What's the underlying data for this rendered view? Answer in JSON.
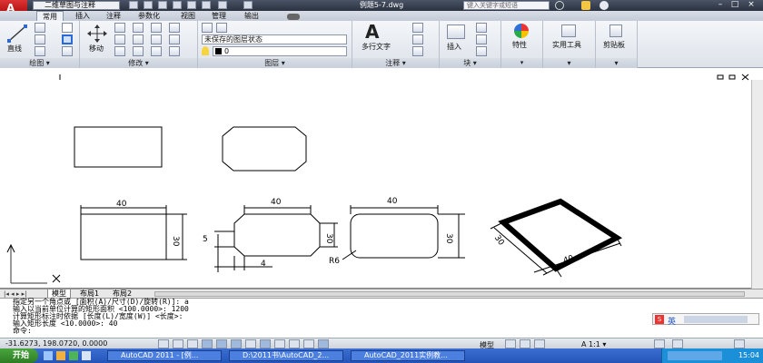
{
  "titlebar": {
    "workspace": "二维草图与注释",
    "doc_title": "例题5-7.dwg",
    "search_placeholder": "键入关键字或短语",
    "minimize": "–",
    "maximize": "□",
    "close": "×"
  },
  "ribbon_tabs": [
    "常用",
    "插入",
    "注释",
    "参数化",
    "视图",
    "管理",
    "输出"
  ],
  "ribbon": {
    "draw": {
      "title": "绘图",
      "line": "直线"
    },
    "modify": {
      "title": "修改",
      "move": "移动"
    },
    "layers": {
      "title": "图层",
      "layer_state": "未保存的图层状态",
      "current_layer": "0"
    },
    "annotation": {
      "title": "注释",
      "mtext": "多行文字"
    },
    "block": {
      "title": "块",
      "insert": "插入"
    },
    "properties": {
      "label": "特性"
    },
    "utilities": {
      "label": "实用工具"
    },
    "clipboard": {
      "label": "剪贴板"
    }
  },
  "drawing": {
    "dims": [
      "40",
      "30",
      "40",
      "30",
      "5",
      "4",
      "R6",
      "40",
      "30",
      "40",
      "30"
    ]
  },
  "layout_tabs": [
    "模型",
    "布局1",
    "布局2"
  ],
  "command_lines": [
    "指定另一个角点或 [面积(A)/尺寸(D)/旋转(R)]: a",
    "输入以当前单位计算的矩形面积 <100.0000>:   1200",
    "计算矩形标注时依据 [长度(L)/宽度(W)] <长度>:",
    "输入矩形长度 <10.0000>:   40",
    "命令:"
  ],
  "ime": {
    "label": "英"
  },
  "status": {
    "coords": "-31.6273, 198.0720, 0.0000",
    "model": "模型",
    "scale": "1:1"
  },
  "taskbar": {
    "start": "开始",
    "tasks": [
      "AutoCAD 2011 - [例...",
      "D:\\2011书\\AutoCAD_2...",
      "AutoCAD_2011实例教..."
    ],
    "clock": "15:04"
  },
  "colors": {
    "ribbon_bg": "#e4e8ef",
    "taskbar": "#2a5bc0",
    "title_bg": "#343b4a"
  }
}
